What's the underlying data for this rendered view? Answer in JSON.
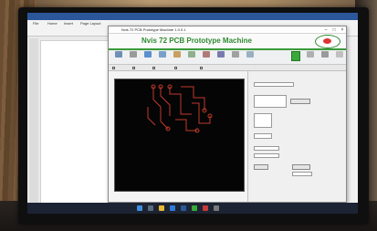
{
  "app": {
    "title": "Nvis 72 PCB Prototype Machine 1.0.0.1",
    "heading": "Nvis 72 PCB Prototype Machine",
    "logo_icon": "nvis-eye-logo-icon",
    "window_controls": [
      "–",
      "□",
      "×"
    ]
  },
  "document": {
    "tabs": [
      "File",
      "Home",
      "Insert",
      "Page Layout"
    ]
  },
  "colors": {
    "brand_green": "#2e8a2e",
    "trace_red": "#c0392b",
    "canvas_bg": "#050505"
  }
}
